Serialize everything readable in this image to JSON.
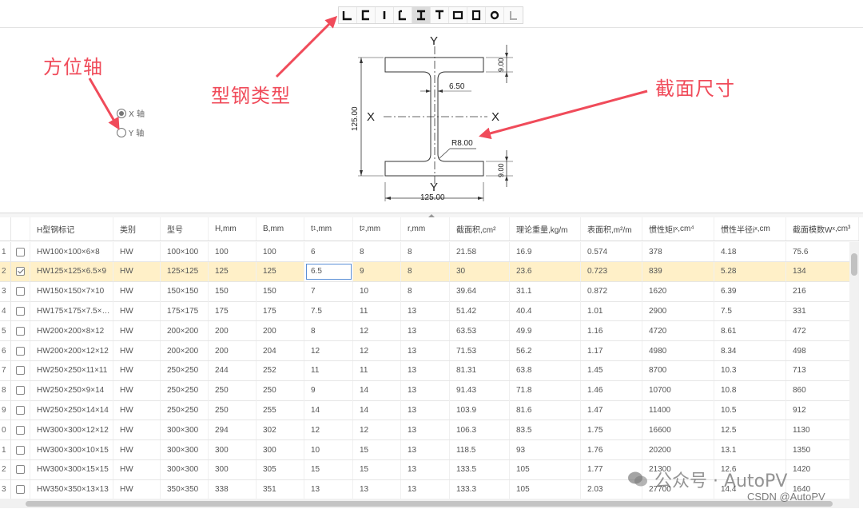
{
  "toolbar": {
    "buttons": [
      {
        "name": "angle-section-icon",
        "active": false
      },
      {
        "name": "channel-section-icon",
        "active": false
      },
      {
        "name": "flat-bar-icon",
        "active": false
      },
      {
        "name": "lipped-channel-icon",
        "active": false
      },
      {
        "name": "h-beam-icon",
        "active": true
      },
      {
        "name": "t-section-icon",
        "active": false
      },
      {
        "name": "rect-tube-icon",
        "active": false
      },
      {
        "name": "square-tube-icon",
        "active": false
      },
      {
        "name": "round-tube-icon",
        "active": false
      },
      {
        "name": "unequal-angle-icon",
        "active": false
      }
    ]
  },
  "axis": {
    "options": [
      {
        "label": "X 轴",
        "checked": true
      },
      {
        "label": "Y 轴",
        "checked": false
      }
    ]
  },
  "annotations": {
    "axis_label": "方位轴",
    "type_label": "型钢类型",
    "size_label": "截面尺寸"
  },
  "profile": {
    "axis_y": "Y",
    "axis_x": "X",
    "height": "125.00",
    "width": "125.00",
    "web": "6.50",
    "flange": "9.00",
    "radius": "R8.00"
  },
  "grid": {
    "columns": [
      "H型钢标记",
      "类别",
      "型号",
      "H,mm",
      "B,mm",
      "t1,mm",
      "t2,mm",
      "r,mm",
      "截面积,cm²",
      "理论重量,kg/m",
      "表面积,m²/m",
      "惯性矩Ix,cm⁴",
      "惯性半径ix,cm",
      "截面模数Wx,cm³"
    ],
    "column_text": {
      "t1": {
        "pre": "t",
        "sub": "1",
        "post": ",mm"
      },
      "t2": {
        "pre": "t",
        "sub": "2",
        "post": ",mm"
      },
      "ix_moment": {
        "pre": "惯性矩I",
        "sub": "x",
        "post": ",cm⁴"
      },
      "ix_radius": {
        "pre": "惯性半径i",
        "sub": "x",
        "post": ",cm"
      },
      "wx": {
        "pre": "截面模数W",
        "sub": "x",
        "post": ",cm³"
      }
    },
    "rows": [
      {
        "num": "1",
        "checked": false,
        "cells": [
          "HW100×100×6×8",
          "HW",
          "100×100",
          "100",
          "100",
          "6",
          "8",
          "8",
          "21.58",
          "16.9",
          "0.574",
          "378",
          "4.18",
          "75.6"
        ]
      },
      {
        "num": "2",
        "checked": true,
        "selected": true,
        "cells": [
          "HW125×125×6.5×9",
          "HW",
          "125×125",
          "125",
          "125",
          "6.5",
          "9",
          "8",
          "30",
          "23.6",
          "0.723",
          "839",
          "5.28",
          "134"
        ]
      },
      {
        "num": "3",
        "checked": false,
        "cells": [
          "HW150×150×7×10",
          "HW",
          "150×150",
          "150",
          "150",
          "7",
          "10",
          "8",
          "39.64",
          "31.1",
          "0.872",
          "1620",
          "6.39",
          "216"
        ]
      },
      {
        "num": "4",
        "checked": false,
        "cells": [
          "HW175×175×7.5×…",
          "HW",
          "175×175",
          "175",
          "175",
          "7.5",
          "11",
          "13",
          "51.42",
          "40.4",
          "1.01",
          "2900",
          "7.5",
          "331"
        ]
      },
      {
        "num": "5",
        "checked": false,
        "cells": [
          "HW200×200×8×12",
          "HW",
          "200×200",
          "200",
          "200",
          "8",
          "12",
          "13",
          "63.53",
          "49.9",
          "1.16",
          "4720",
          "8.61",
          "472"
        ]
      },
      {
        "num": "6",
        "checked": false,
        "cells": [
          "HW200×200×12×12",
          "HW",
          "200×200",
          "200",
          "204",
          "12",
          "12",
          "13",
          "71.53",
          "56.2",
          "1.17",
          "4980",
          "8.34",
          "498"
        ]
      },
      {
        "num": "7",
        "checked": false,
        "cells": [
          "HW250×250×11×11",
          "HW",
          "250×250",
          "244",
          "252",
          "11",
          "11",
          "13",
          "81.31",
          "63.8",
          "1.45",
          "8700",
          "10.3",
          "713"
        ]
      },
      {
        "num": "8",
        "checked": false,
        "cells": [
          "HW250×250×9×14",
          "HW",
          "250×250",
          "250",
          "250",
          "9",
          "14",
          "13",
          "91.43",
          "71.8",
          "1.46",
          "10700",
          "10.8",
          "860"
        ]
      },
      {
        "num": "9",
        "checked": false,
        "cells": [
          "HW250×250×14×14",
          "HW",
          "250×250",
          "250",
          "255",
          "14",
          "14",
          "13",
          "103.9",
          "81.6",
          "1.47",
          "11400",
          "10.5",
          "912"
        ]
      },
      {
        "num": "0",
        "checked": false,
        "cells": [
          "HW300×300×12×12",
          "HW",
          "300×300",
          "294",
          "302",
          "12",
          "12",
          "13",
          "106.3",
          "83.5",
          "1.75",
          "16600",
          "12.5",
          "1130"
        ]
      },
      {
        "num": "1",
        "checked": false,
        "cells": [
          "HW300×300×10×15",
          "HW",
          "300×300",
          "300",
          "300",
          "10",
          "15",
          "13",
          "118.5",
          "93",
          "1.76",
          "20200",
          "13.1",
          "1350"
        ]
      },
      {
        "num": "2",
        "checked": false,
        "cells": [
          "HW300×300×15×15",
          "HW",
          "300×300",
          "300",
          "305",
          "15",
          "15",
          "13",
          "133.5",
          "105",
          "1.77",
          "21300",
          "12.6",
          "1420"
        ]
      },
      {
        "num": "3",
        "checked": false,
        "cells": [
          "HW350×350×13×13",
          "HW",
          "350×350",
          "338",
          "351",
          "13",
          "13",
          "13",
          "133.3",
          "105",
          "2.03",
          "27700",
          "14.4",
          "1640"
        ]
      }
    ]
  },
  "watermark": {
    "brand": "公众号 · AutoPV",
    "csdn": "CSDN @AutoPV"
  },
  "colors": {
    "annotation": "#f04b5a",
    "selected_row": "#fff0c8"
  }
}
